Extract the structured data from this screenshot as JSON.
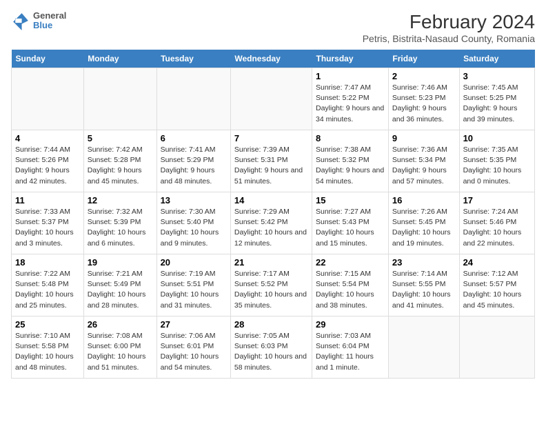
{
  "header": {
    "logo_line1": "General",
    "logo_line2": "Blue",
    "title": "February 2024",
    "subtitle": "Petris, Bistrita-Nasaud County, Romania"
  },
  "days_of_week": [
    "Sunday",
    "Monday",
    "Tuesday",
    "Wednesday",
    "Thursday",
    "Friday",
    "Saturday"
  ],
  "weeks": [
    [
      {
        "day": "",
        "empty": true
      },
      {
        "day": "",
        "empty": true
      },
      {
        "day": "",
        "empty": true
      },
      {
        "day": "",
        "empty": true
      },
      {
        "day": "1",
        "sunrise": "7:47 AM",
        "sunset": "5:22 PM",
        "daylight": "9 hours and 34 minutes."
      },
      {
        "day": "2",
        "sunrise": "7:46 AM",
        "sunset": "5:23 PM",
        "daylight": "9 hours and 36 minutes."
      },
      {
        "day": "3",
        "sunrise": "7:45 AM",
        "sunset": "5:25 PM",
        "daylight": "9 hours and 39 minutes."
      }
    ],
    [
      {
        "day": "4",
        "sunrise": "7:44 AM",
        "sunset": "5:26 PM",
        "daylight": "9 hours and 42 minutes."
      },
      {
        "day": "5",
        "sunrise": "7:42 AM",
        "sunset": "5:28 PM",
        "daylight": "9 hours and 45 minutes."
      },
      {
        "day": "6",
        "sunrise": "7:41 AM",
        "sunset": "5:29 PM",
        "daylight": "9 hours and 48 minutes."
      },
      {
        "day": "7",
        "sunrise": "7:39 AM",
        "sunset": "5:31 PM",
        "daylight": "9 hours and 51 minutes."
      },
      {
        "day": "8",
        "sunrise": "7:38 AM",
        "sunset": "5:32 PM",
        "daylight": "9 hours and 54 minutes."
      },
      {
        "day": "9",
        "sunrise": "7:36 AM",
        "sunset": "5:34 PM",
        "daylight": "9 hours and 57 minutes."
      },
      {
        "day": "10",
        "sunrise": "7:35 AM",
        "sunset": "5:35 PM",
        "daylight": "10 hours and 0 minutes."
      }
    ],
    [
      {
        "day": "11",
        "sunrise": "7:33 AM",
        "sunset": "5:37 PM",
        "daylight": "10 hours and 3 minutes."
      },
      {
        "day": "12",
        "sunrise": "7:32 AM",
        "sunset": "5:39 PM",
        "daylight": "10 hours and 6 minutes."
      },
      {
        "day": "13",
        "sunrise": "7:30 AM",
        "sunset": "5:40 PM",
        "daylight": "10 hours and 9 minutes."
      },
      {
        "day": "14",
        "sunrise": "7:29 AM",
        "sunset": "5:42 PM",
        "daylight": "10 hours and 12 minutes."
      },
      {
        "day": "15",
        "sunrise": "7:27 AM",
        "sunset": "5:43 PM",
        "daylight": "10 hours and 15 minutes."
      },
      {
        "day": "16",
        "sunrise": "7:26 AM",
        "sunset": "5:45 PM",
        "daylight": "10 hours and 19 minutes."
      },
      {
        "day": "17",
        "sunrise": "7:24 AM",
        "sunset": "5:46 PM",
        "daylight": "10 hours and 22 minutes."
      }
    ],
    [
      {
        "day": "18",
        "sunrise": "7:22 AM",
        "sunset": "5:48 PM",
        "daylight": "10 hours and 25 minutes."
      },
      {
        "day": "19",
        "sunrise": "7:21 AM",
        "sunset": "5:49 PM",
        "daylight": "10 hours and 28 minutes."
      },
      {
        "day": "20",
        "sunrise": "7:19 AM",
        "sunset": "5:51 PM",
        "daylight": "10 hours and 31 minutes."
      },
      {
        "day": "21",
        "sunrise": "7:17 AM",
        "sunset": "5:52 PM",
        "daylight": "10 hours and 35 minutes."
      },
      {
        "day": "22",
        "sunrise": "7:15 AM",
        "sunset": "5:54 PM",
        "daylight": "10 hours and 38 minutes."
      },
      {
        "day": "23",
        "sunrise": "7:14 AM",
        "sunset": "5:55 PM",
        "daylight": "10 hours and 41 minutes."
      },
      {
        "day": "24",
        "sunrise": "7:12 AM",
        "sunset": "5:57 PM",
        "daylight": "10 hours and 45 minutes."
      }
    ],
    [
      {
        "day": "25",
        "sunrise": "7:10 AM",
        "sunset": "5:58 PM",
        "daylight": "10 hours and 48 minutes."
      },
      {
        "day": "26",
        "sunrise": "7:08 AM",
        "sunset": "6:00 PM",
        "daylight": "10 hours and 51 minutes."
      },
      {
        "day": "27",
        "sunrise": "7:06 AM",
        "sunset": "6:01 PM",
        "daylight": "10 hours and 54 minutes."
      },
      {
        "day": "28",
        "sunrise": "7:05 AM",
        "sunset": "6:03 PM",
        "daylight": "10 hours and 58 minutes."
      },
      {
        "day": "29",
        "sunrise": "7:03 AM",
        "sunset": "6:04 PM",
        "daylight": "11 hours and 1 minute."
      },
      {
        "day": "",
        "empty": true
      },
      {
        "day": "",
        "empty": true
      }
    ]
  ],
  "labels": {
    "sunrise": "Sunrise:",
    "sunset": "Sunset:",
    "daylight": "Daylight:"
  }
}
